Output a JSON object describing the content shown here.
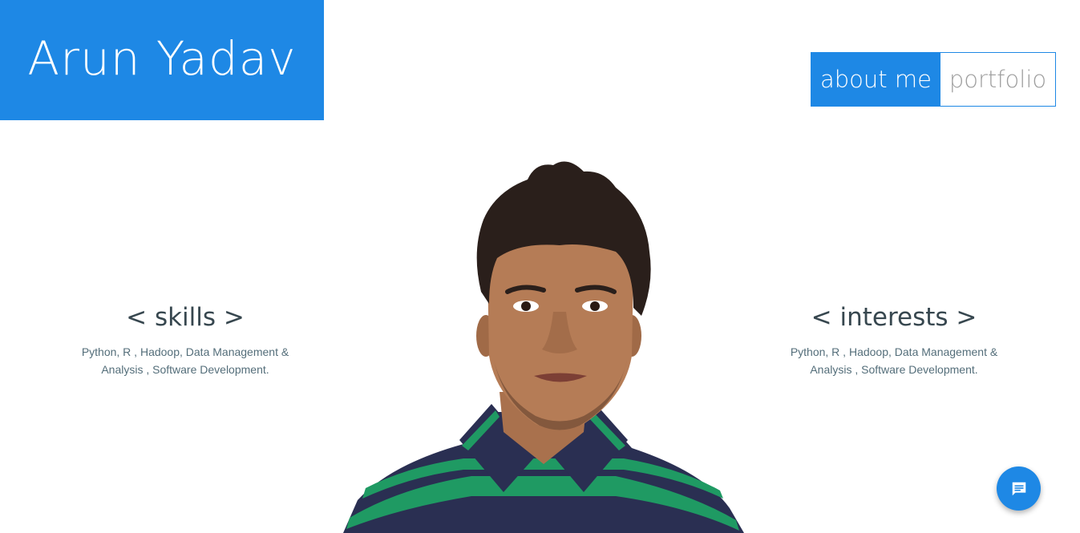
{
  "header": {
    "name": "Arun Yadav"
  },
  "nav": {
    "items": [
      {
        "label": "about me",
        "active": true
      },
      {
        "label": "portfolio",
        "active": false
      }
    ]
  },
  "skills": {
    "title": "< skills >",
    "text": "Python, R , Hadoop, Data Management & Analysis , Software Development."
  },
  "interests": {
    "title": "< interests >",
    "text": "Python, R , Hadoop, Data Management & Analysis , Software Development."
  },
  "chat": {
    "icon": "chat-icon"
  },
  "colors": {
    "accent": "#1e88e5",
    "text_dark": "#37474f",
    "text_muted": "#546e7a"
  }
}
